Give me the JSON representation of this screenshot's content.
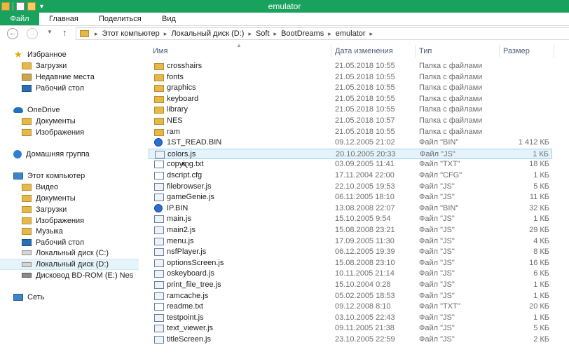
{
  "window": {
    "title": "emulator"
  },
  "ribbon": {
    "tabs": [
      "Файл",
      "Главная",
      "Поделиться",
      "Вид"
    ]
  },
  "address": {
    "crumbs": [
      "Этот компьютер",
      "Локальный диск (D:)",
      "Soft",
      "BootDreams",
      "emulator"
    ]
  },
  "nav": {
    "items": [
      {
        "label": "Избранное",
        "icon": "star-icon",
        "indent": 0
      },
      {
        "label": "Загрузки",
        "icon": "downloads-folder-icon",
        "indent": 1
      },
      {
        "label": "Недавние места",
        "icon": "recent-places-icon",
        "indent": 1
      },
      {
        "label": "Рабочий стол",
        "icon": "desktop-icon",
        "indent": 1
      },
      {
        "label": "OneDrive",
        "icon": "onedrive-cloud-icon",
        "indent": 0
      },
      {
        "label": "Документы",
        "icon": "folder-icon",
        "indent": 1
      },
      {
        "label": "Изображения",
        "icon": "folder-icon",
        "indent": 1
      },
      {
        "label": "Домашняя группа",
        "icon": "homegroup-icon",
        "indent": 0
      },
      {
        "label": "Этот компьютер",
        "icon": "computer-icon",
        "indent": 0
      },
      {
        "label": "Видео",
        "icon": "folder-icon",
        "indent": 1
      },
      {
        "label": "Документы",
        "icon": "folder-icon",
        "indent": 1
      },
      {
        "label": "Загрузки",
        "icon": "downloads-folder-icon",
        "indent": 1
      },
      {
        "label": "Изображения",
        "icon": "folder-icon",
        "indent": 1
      },
      {
        "label": "Музыка",
        "icon": "folder-icon",
        "indent": 1
      },
      {
        "label": "Рабочий стол",
        "icon": "desktop-icon",
        "indent": 1
      },
      {
        "label": "Локальный диск (C:)",
        "icon": "drive-icon",
        "indent": 1
      },
      {
        "label": "Локальный диск (D:)",
        "icon": "drive-icon",
        "indent": 1,
        "selected": true
      },
      {
        "label": "Дисковод BD-ROM (E:) Nes",
        "icon": "bd-rom-icon",
        "indent": 1
      },
      {
        "label": "Сеть",
        "icon": "network-icon",
        "indent": 0
      }
    ]
  },
  "columns": {
    "name": "Имя",
    "date": "Дата изменения",
    "type": "Тип",
    "size": "Размер"
  },
  "files": [
    {
      "name": "crosshairs",
      "date": "21.05.2018 10:55",
      "type": "Папка с файлами",
      "size": "",
      "kind": "folder"
    },
    {
      "name": "fonts",
      "date": "21.05.2018 10:55",
      "type": "Папка с файлами",
      "size": "",
      "kind": "folder"
    },
    {
      "name": "graphics",
      "date": "21.05.2018 10:55",
      "type": "Папка с файлами",
      "size": "",
      "kind": "folder"
    },
    {
      "name": "keyboard",
      "date": "21.05.2018 10:55",
      "type": "Папка с файлами",
      "size": "",
      "kind": "folder"
    },
    {
      "name": "library",
      "date": "21.05.2018 10:55",
      "type": "Папка с файлами",
      "size": "",
      "kind": "folder"
    },
    {
      "name": "NES",
      "date": "21.05.2018 10:57",
      "type": "Папка с файлами",
      "size": "",
      "kind": "folder"
    },
    {
      "name": "ram",
      "date": "21.05.2018 10:55",
      "type": "Папка с файлами",
      "size": "",
      "kind": "folder"
    },
    {
      "name": "1ST_READ.BIN",
      "date": "09.12.2005 21:02",
      "type": "Файл \"BIN\"",
      "size": "1 412 КБ",
      "kind": "bin"
    },
    {
      "name": "colors.js",
      "date": "20.10.2005 20:33",
      "type": "Файл \"JS\"",
      "size": "1 КБ",
      "kind": "js",
      "selected": true
    },
    {
      "name": "copying.txt",
      "date": "03.09.2005 11:41",
      "type": "Файл \"TXT\"",
      "size": "18 КБ",
      "kind": "txt"
    },
    {
      "name": "dscript.cfg",
      "date": "17.11.2004 22:00",
      "type": "Файл \"CFG\"",
      "size": "1 КБ",
      "kind": "file"
    },
    {
      "name": "filebrowser.js",
      "date": "22.10.2005 19:53",
      "type": "Файл \"JS\"",
      "size": "5 КБ",
      "kind": "js"
    },
    {
      "name": "gameGenie.js",
      "date": "06.11.2005 18:10",
      "type": "Файл \"JS\"",
      "size": "11 КБ",
      "kind": "js"
    },
    {
      "name": "IP.BIN",
      "date": "13.08.2008 22:07",
      "type": "Файл \"BIN\"",
      "size": "32 КБ",
      "kind": "bin"
    },
    {
      "name": "main.js",
      "date": "15.10.2005 9:54",
      "type": "Файл \"JS\"",
      "size": "1 КБ",
      "kind": "js"
    },
    {
      "name": "main2.js",
      "date": "15.08.2008 23:21",
      "type": "Файл \"JS\"",
      "size": "29 КБ",
      "kind": "js"
    },
    {
      "name": "menu.js",
      "date": "17.09.2005 11:30",
      "type": "Файл \"JS\"",
      "size": "4 КБ",
      "kind": "js"
    },
    {
      "name": "nsfPlayer.js",
      "date": "06.12.2005 19:39",
      "type": "Файл \"JS\"",
      "size": "8 КБ",
      "kind": "js"
    },
    {
      "name": "optionsScreen.js",
      "date": "15.08.2008 23:10",
      "type": "Файл \"JS\"",
      "size": "16 КБ",
      "kind": "js"
    },
    {
      "name": "oskeyboard.js",
      "date": "10.11.2005 21:14",
      "type": "Файл \"JS\"",
      "size": "6 КБ",
      "kind": "js"
    },
    {
      "name": "print_file_tree.js",
      "date": "15.10.2004 0:28",
      "type": "Файл \"JS\"",
      "size": "1 КБ",
      "kind": "js"
    },
    {
      "name": "ramcache.js",
      "date": "05.02.2005 18:53",
      "type": "Файл \"JS\"",
      "size": "1 КБ",
      "kind": "js"
    },
    {
      "name": "readme.txt",
      "date": "09.12.2008 8:10",
      "type": "Файл \"TXT\"",
      "size": "20 КБ",
      "kind": "txt"
    },
    {
      "name": "testpoint.js",
      "date": "03.10.2005 22:43",
      "type": "Файл \"JS\"",
      "size": "1 КБ",
      "kind": "js"
    },
    {
      "name": "text_viewer.js",
      "date": "09.11.2005 21:38",
      "type": "Файл \"JS\"",
      "size": "5 КБ",
      "kind": "js"
    },
    {
      "name": "titleScreen.js",
      "date": "23.10.2005 22:59",
      "type": "Файл \"JS\"",
      "size": "2 КБ",
      "kind": "js"
    }
  ],
  "colors": {
    "accent": "#19a25d",
    "selection": "#e5f3fb",
    "selection_border": "#99d1ff",
    "folder": "#e6b84a"
  }
}
